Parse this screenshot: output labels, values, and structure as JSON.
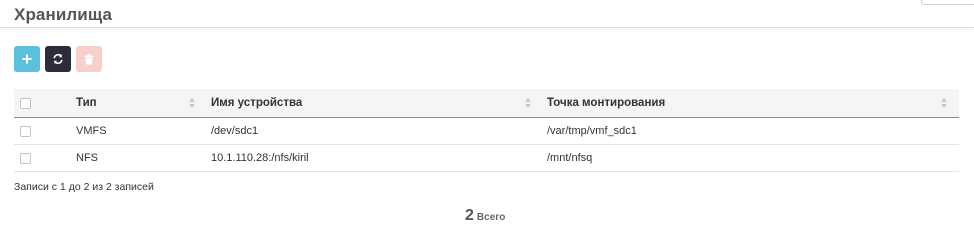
{
  "page": {
    "title": "Хранилища"
  },
  "toolbar": {
    "buttons": [
      {
        "icon": "plus-icon",
        "color": "#5bc0de"
      },
      {
        "icon": "refresh-icon",
        "color": "#2b2d3a"
      },
      {
        "icon": "trash-icon",
        "color": "#f7cfcb"
      }
    ]
  },
  "table": {
    "columns": [
      "Тип",
      "Имя устройства",
      "Точка монтирования"
    ],
    "rows": [
      {
        "type": "VMFS",
        "device": "/dev/sdc1",
        "mount": "/var/tmp/vmf_sdc1"
      },
      {
        "type": "NFS",
        "device": "10.1.110.28:/nfs/kiril",
        "mount": "/mnt/nfsq"
      }
    ]
  },
  "footer": {
    "records_info": "Записи с 1 до 2 из 2 записей",
    "total_count": "2",
    "total_label": "Всего"
  }
}
